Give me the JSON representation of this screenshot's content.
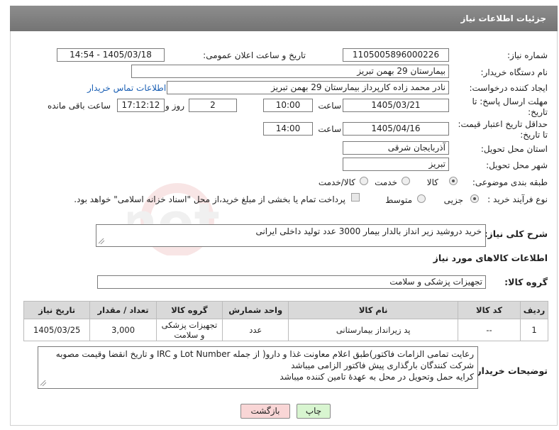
{
  "header": {
    "title": "جزئیات اطلاعات نیاز"
  },
  "fields": {
    "need_number_label": "شماره نیاز:",
    "need_number": "1105005896000226",
    "announce_label": "تاریخ و ساعت اعلان عمومی:",
    "announce_value": "1405/03/18 - 14:54",
    "buyer_org_label": "نام دستگاه خریدار:",
    "buyer_org": "بیمارستان 29 بهمن تبریز",
    "requester_label": "ایجاد کننده درخواست:",
    "requester": "نادر محمد زاده کارپرداز بیمارستان 29 بهمن تبریز",
    "buyer_contact_link": "اطلاعات تماس خریدار",
    "reply_deadline_label": "مهلت ارسال پاسخ: تا تاریخ:",
    "reply_date": "1405/03/21",
    "time_label": "ساعت",
    "reply_time": "10:00",
    "days_value": "2",
    "days_label": "روز و",
    "remaining_time": "17:12:12",
    "remaining_label": "ساعت باقی مانده",
    "price_validity_label": "حداقل تاریخ اعتبار قیمت: تا تاریخ:",
    "price_date": "1405/04/16",
    "price_time": "14:00",
    "province_label": "استان محل تحویل:",
    "province": "آذربایجان شرقی",
    "city_label": "شهر محل تحویل:",
    "city": "تبریز",
    "category_label": "طبقه بندی موضوعی:",
    "category_options": [
      "کالا",
      "خدمت",
      "کالا/خدمت"
    ],
    "process_label": "نوع فرآیند خرید :",
    "process_options": [
      "جزیی",
      "متوسط"
    ],
    "payment_note": "پرداخت تمام یا بخشی از مبلغ خرید،از محل \"اسناد خزانه اسلامی\" خواهد بود.",
    "summary_label": "شرح کلی نیاز:",
    "summary": "خرید دروشید زیر انداز بالدار بیمار 3000 عدد تولید داخلی ایرانی",
    "goods_info_title": "اطلاعات کالاهای مورد نیاز",
    "goods_group_label": "گروه کالا:",
    "goods_group": "تجهیزات پزشکی و سلامت"
  },
  "table": {
    "headers": [
      "ردیف",
      "کد کالا",
      "نام کالا",
      "واحد شمارش",
      "گروه کالا",
      "تعداد / مقدار",
      "تاریخ نیاز"
    ],
    "rows": [
      [
        "1",
        "--",
        "پد زیرانداز بیمارستانی",
        "عدد",
        "تجهیزات پزشکی و سلامت",
        "3,000",
        "1405/03/25"
      ]
    ]
  },
  "buyer_notes_label": "توضیحات خریدار:",
  "buyer_notes": [
    "رعایت تمامی الزامات فاکتور)طبق اعلام معاونت غذا و دارو( از جمله Lot Number و IRC و تاریخ انقضا وقیمت مصوبه",
    "شرکت کنندگان بارگذاری پیش فاکتور الزامی میباشد",
    "کرایه حمل وتحویل در محل به عهدهٔ تامین کننده میباشد"
  ],
  "buttons": {
    "print": "چاپ",
    "back": "بازگشت"
  },
  "watermark": "AriaTender.net",
  "colors": {
    "header_bg": "#7f7f7f",
    "link": "#1a5fb4",
    "back_btn": "#f9d6d6",
    "print_btn": "#d8f5d0"
  }
}
